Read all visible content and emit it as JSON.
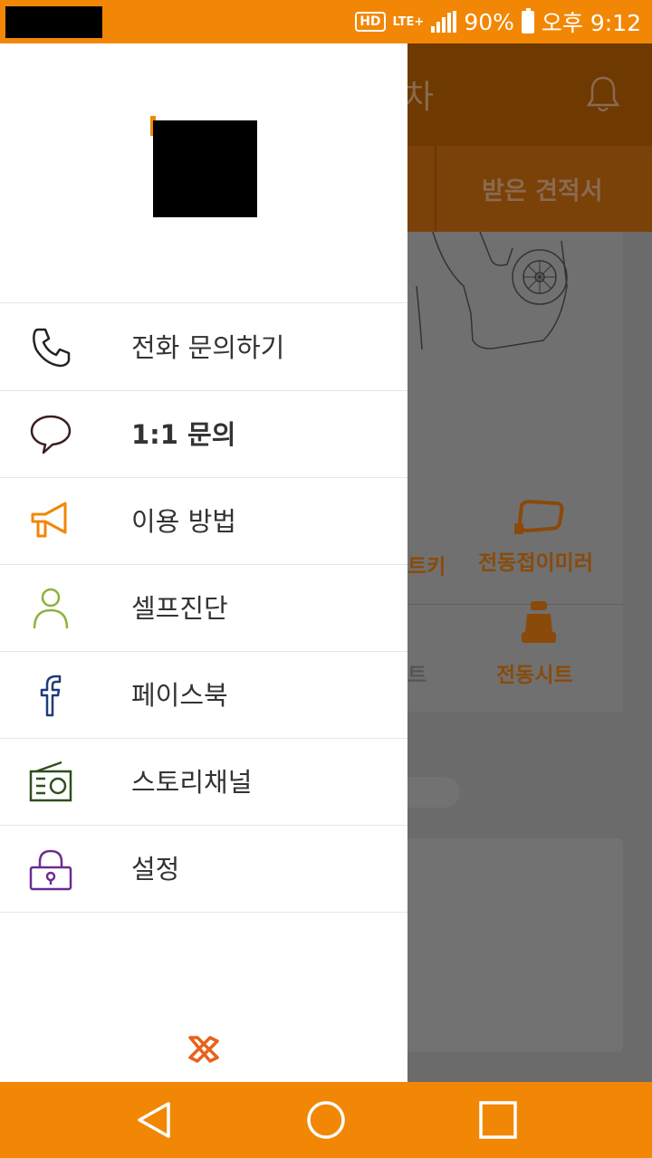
{
  "status_bar": {
    "hd_label": "HD",
    "network_label": "LTE+",
    "battery_percent": "90%",
    "time": "오후 9:12",
    "background_color": "#f28705"
  },
  "background_app": {
    "title_fragment": "차",
    "tab_label": "받은 견적서",
    "feature_key_fragment": "트키",
    "feature_mirror": "전동접이미러",
    "feature_seat_fragment": "트",
    "feature_seat": "전동시트",
    "icons": [
      "bell-icon",
      "car-illustration",
      "mirror-icon",
      "seat-icon"
    ]
  },
  "drawer": {
    "menu": [
      {
        "label": "전화 문의하기",
        "icon": "phone-icon",
        "icon_color": "#222222",
        "bold": false
      },
      {
        "label": "1:1 문의",
        "icon": "chat-bubble-icon",
        "icon_color": "#3a1e1e",
        "bold": true
      },
      {
        "label": "이용 방법",
        "icon": "megaphone-icon",
        "icon_color": "#f28705",
        "bold": false
      },
      {
        "label": "셀프진단",
        "icon": "person-icon",
        "icon_color": "#8bb33a",
        "bold": false
      },
      {
        "label": "페이스북",
        "icon": "facebook-icon",
        "icon_color": "#1f3b7a",
        "bold": false
      },
      {
        "label": "스토리채널",
        "icon": "radio-icon",
        "icon_color": "#2f4f1f",
        "bold": false
      },
      {
        "label": "설정",
        "icon": "lock-icon",
        "icon_color": "#6a2c91",
        "bold": false
      }
    ],
    "footer_icon": "brand-logo-icon",
    "accent_color": "#f28705"
  },
  "nav_bar": {
    "buttons": [
      "back-icon",
      "home-icon",
      "recents-icon"
    ],
    "background_color": "#f28705"
  }
}
